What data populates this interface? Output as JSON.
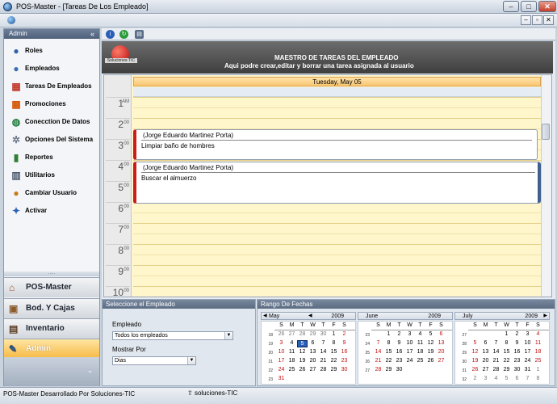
{
  "window": {
    "title": "POS-Master - [Tareas De Los Empleado]",
    "min": "–",
    "max": "□",
    "close": "✕"
  },
  "mdi": {
    "min": "–",
    "restore": "▫",
    "close": "✕"
  },
  "sidebar": {
    "header": "Admin",
    "collapse": "«",
    "items": [
      {
        "label": "Roles",
        "icon": "roles-icon"
      },
      {
        "label": "Empleados",
        "icon": "employees-icon"
      },
      {
        "label": "Tareas De Empleados",
        "icon": "calendar-icon"
      },
      {
        "label": "Promociones",
        "icon": "promotions-icon"
      },
      {
        "label": "Conecction De Datos",
        "icon": "globe-icon"
      },
      {
        "label": "Opciones Del Sistema",
        "icon": "gears-icon"
      },
      {
        "label": "Reportes",
        "icon": "chart-icon"
      },
      {
        "label": "Utilitarios",
        "icon": "tools-icon"
      },
      {
        "label": "Cambiar Usuario",
        "icon": "user-icon"
      },
      {
        "label": "Activar",
        "icon": "activate-icon"
      }
    ],
    "groups": [
      {
        "label": "POS-Master",
        "icon": "house-icon"
      },
      {
        "label": "Bod. Y Cajas",
        "icon": "boxes-icon"
      },
      {
        "label": "Inventario",
        "icon": "inventory-icon"
      },
      {
        "label": "Admin",
        "icon": "admin-icon"
      }
    ]
  },
  "header": {
    "logo_text": "Soluciones-TIC",
    "title": "MAESTRO DE TAREAS DEL EMPLEADO",
    "subtitle": "Aqui podre crear,editar y borrar una tarea asignada al usuario"
  },
  "calendar": {
    "date": "Tuesday, May 05",
    "hours": [
      {
        "h": "1",
        "m": "AM"
      },
      {
        "h": "2",
        "m": "00"
      },
      {
        "h": "3",
        "m": "00"
      },
      {
        "h": "4",
        "m": "00"
      },
      {
        "h": "5",
        "m": "00"
      },
      {
        "h": "6",
        "m": "00"
      },
      {
        "h": "7",
        "m": "00"
      },
      {
        "h": "8",
        "m": "00"
      },
      {
        "h": "9",
        "m": "00"
      },
      {
        "h": "10",
        "m": "00"
      }
    ],
    "appointments": [
      {
        "who": "(Jorge Eduardo  Martinez Porta)",
        "task": "Limpiar baño de hombres"
      },
      {
        "who": "(Jorge Eduardo  Martinez Porta)",
        "task": "Buscar el almuerzo"
      }
    ]
  },
  "employee_panel": {
    "header": "Seleccione el Empleado",
    "employee_label": "Empleado",
    "employee_value": "Todos los empleados",
    "show_label": "Mostrar Por",
    "show_value": "Dias"
  },
  "range_panel": {
    "header": "Rango De Fechas",
    "dow": [
      "S",
      "M",
      "T",
      "W",
      "T",
      "F",
      "S"
    ],
    "months": [
      {
        "name": "May",
        "year": "2009",
        "weeks": [
          "18",
          "19",
          "20",
          "21",
          "22",
          "23"
        ],
        "days": [
          [
            "26",
            "27",
            "28",
            "29",
            "30",
            "1",
            "2"
          ],
          [
            "3",
            "4",
            "5",
            "6",
            "7",
            "8",
            "9"
          ],
          [
            "10",
            "11",
            "12",
            "13",
            "14",
            "15",
            "16"
          ],
          [
            "17",
            "18",
            "19",
            "20",
            "21",
            "22",
            "23"
          ],
          [
            "24",
            "25",
            "26",
            "27",
            "28",
            "29",
            "30"
          ],
          [
            "31",
            "",
            "",
            "",
            "",
            "",
            ""
          ]
        ]
      },
      {
        "name": "June",
        "year": "2009",
        "weeks": [
          "23",
          "24",
          "25",
          "26",
          "27"
        ],
        "days": [
          [
            "",
            "1",
            "2",
            "3",
            "4",
            "5",
            "6"
          ],
          [
            "7",
            "8",
            "9",
            "10",
            "11",
            "12",
            "13"
          ],
          [
            "14",
            "15",
            "16",
            "17",
            "18",
            "19",
            "20"
          ],
          [
            "21",
            "22",
            "23",
            "24",
            "25",
            "26",
            "27"
          ],
          [
            "28",
            "29",
            "30",
            "",
            "",
            "",
            ""
          ]
        ]
      },
      {
        "name": "July",
        "year": "2009",
        "weeks": [
          "27",
          "28",
          "29",
          "30",
          "31",
          "32"
        ],
        "days": [
          [
            "",
            "",
            "",
            "1",
            "2",
            "3",
            "4"
          ],
          [
            "5",
            "6",
            "7",
            "8",
            "9",
            "10",
            "11"
          ],
          [
            "12",
            "13",
            "14",
            "15",
            "16",
            "17",
            "18"
          ],
          [
            "19",
            "20",
            "21",
            "22",
            "23",
            "24",
            "25"
          ],
          [
            "26",
            "27",
            "28",
            "29",
            "30",
            "31",
            "1"
          ],
          [
            "2",
            "3",
            "4",
            "5",
            "6",
            "7",
            "8"
          ]
        ]
      }
    ]
  },
  "status": {
    "left": "POS-Master Desarrollado Por Soluciones-TIC",
    "right": "soluciones-TIC"
  },
  "colors": {
    "accent": "#f6b742",
    "appointment_bar": "#c81e1e",
    "header": "#4e4e4e"
  }
}
